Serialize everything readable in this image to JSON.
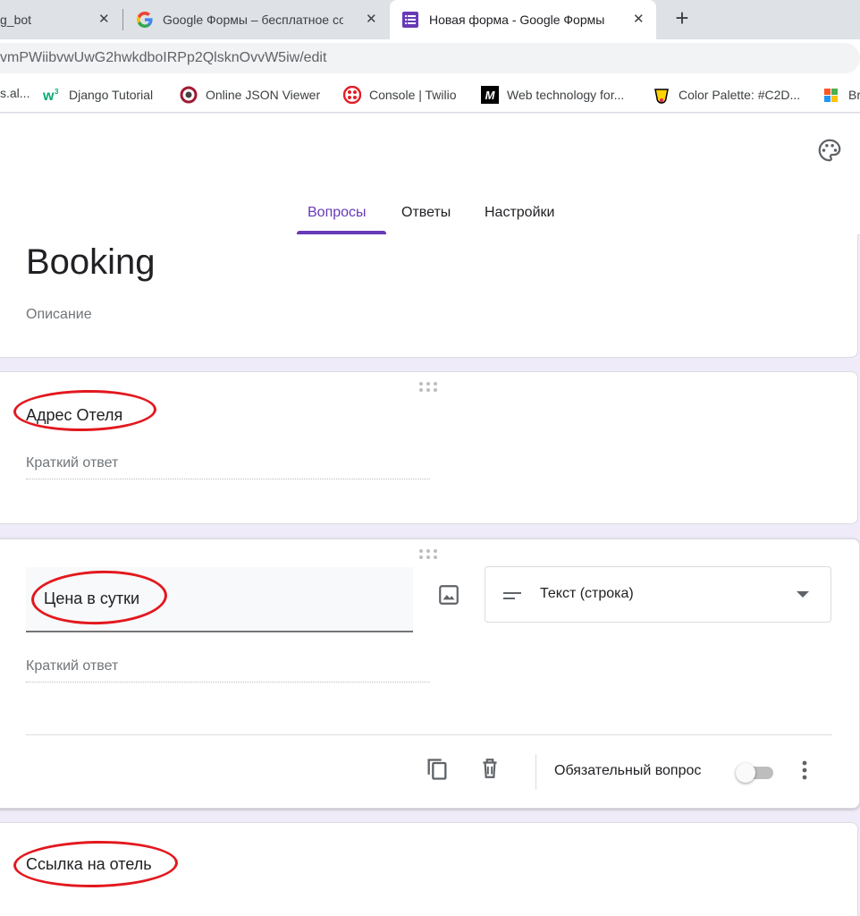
{
  "browser": {
    "tabs": [
      {
        "title": "g_bot"
      },
      {
        "title": "Google Формы – бесплатное со"
      },
      {
        "title": "Новая форма - Google Формы"
      }
    ],
    "new_tab": "+",
    "close": "✕",
    "url": "vmPWiibvwUwG2hwkdboIRPp2QlsknOvvW5iw/edit",
    "bookmarks": [
      {
        "label": "s.al...",
        "icon": "none"
      },
      {
        "label": "Django Tutorial",
        "icon": "w3schools-icon"
      },
      {
        "label": "Online JSON Viewer",
        "icon": "json-viewer-icon"
      },
      {
        "label": "Console | Twilio",
        "icon": "twilio-icon"
      },
      {
        "label": "Web technology for...",
        "icon": "mdn-icon"
      },
      {
        "label": "Color Palette: #C2D...",
        "icon": "palette-site-icon"
      },
      {
        "label": "Br",
        "icon": "colorful-icon"
      }
    ]
  },
  "forms": {
    "nav": {
      "questions": "Вопросы",
      "responses": "Ответы",
      "settings": "Настройки"
    },
    "form": {
      "title": "Booking",
      "description": "Описание"
    },
    "questions": [
      {
        "title": "Адрес Отеля",
        "answer_placeholder": "Краткий ответ"
      },
      {
        "title": "Цена в сутки",
        "answer_placeholder": "Краткий ответ",
        "type": "Текст (строка)",
        "required_label": "Обязательный вопрос",
        "required": false
      },
      {
        "title": "Ссылка на отель"
      }
    ],
    "colors": {
      "accent": "#673ab7",
      "background": "#f0ebf8",
      "active_card_border": "#4285f4",
      "annotation": "#e3181e"
    }
  }
}
